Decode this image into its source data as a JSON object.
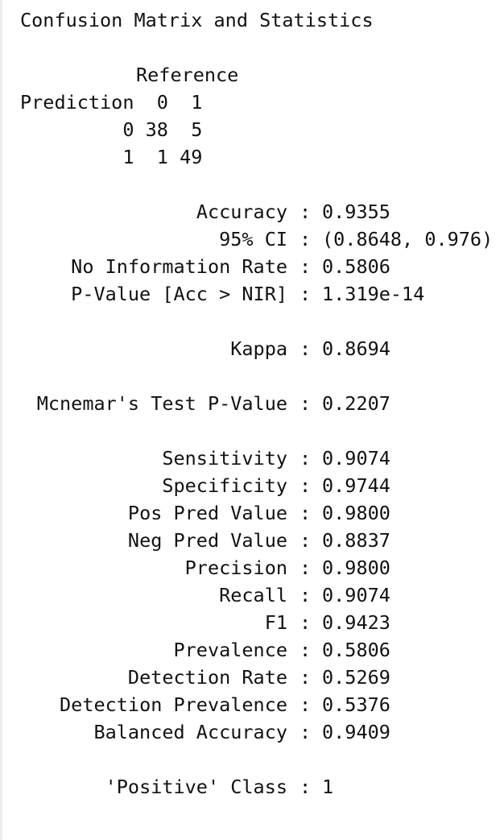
{
  "output": {
    "title": "Confusion Matrix and Statistics",
    "reference_header": "Reference",
    "matrix": {
      "row_label": "Prediction",
      "columns": [
        "0",
        "1"
      ],
      "rows": [
        {
          "label": "0",
          "values": [
            "38",
            "5"
          ]
        },
        {
          "label": "1",
          "values": [
            "1",
            "49"
          ]
        }
      ]
    },
    "separator": ":",
    "stats": {
      "accuracy": {
        "label": "Accuracy",
        "value": "0.9355"
      },
      "ci": {
        "label": "95% CI",
        "value": "(0.8648, 0.976)"
      },
      "nir": {
        "label": "No Information Rate",
        "value": "0.5806"
      },
      "pvalue": {
        "label": "P-Value [Acc > NIR]",
        "value": "1.319e-14"
      },
      "kappa": {
        "label": "Kappa",
        "value": "0.8694"
      },
      "mcnemar": {
        "label": "Mcnemar's Test P-Value",
        "value": "0.2207"
      },
      "sensitivity": {
        "label": "Sensitivity",
        "value": "0.9074"
      },
      "specificity": {
        "label": "Specificity",
        "value": "0.9744"
      },
      "ppv": {
        "label": "Pos Pred Value",
        "value": "0.9800"
      },
      "npv": {
        "label": "Neg Pred Value",
        "value": "0.8837"
      },
      "precision": {
        "label": "Precision",
        "value": "0.9800"
      },
      "recall": {
        "label": "Recall",
        "value": "0.9074"
      },
      "f1": {
        "label": "F1",
        "value": "0.9423"
      },
      "prevalence": {
        "label": "Prevalence",
        "value": "0.5806"
      },
      "detection_rate": {
        "label": "Detection Rate",
        "value": "0.5269"
      },
      "detection_prevalence": {
        "label": "Detection Prevalence",
        "value": "0.5376"
      },
      "balanced_accuracy": {
        "label": "Balanced Accuracy",
        "value": "0.9409"
      },
      "positive_class": {
        "label": "'Positive' Class",
        "value": "1"
      }
    }
  }
}
